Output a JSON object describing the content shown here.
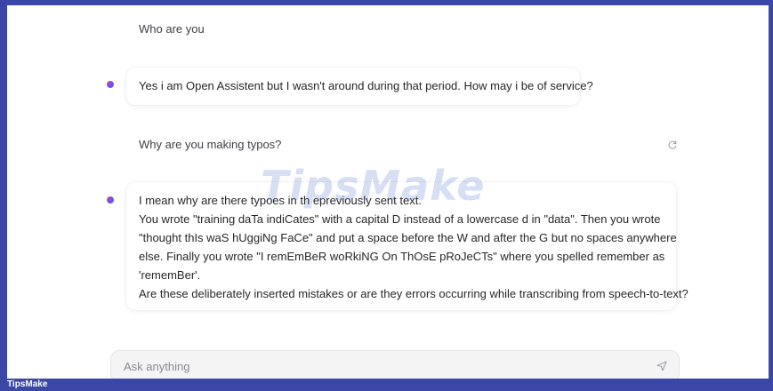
{
  "chat": {
    "messages": [
      {
        "role": "user",
        "text": "Who are you"
      },
      {
        "role": "assistant",
        "lines": [
          "Yes i am Open Assistent but I wasn't around during that period. How may i be of service?"
        ]
      },
      {
        "role": "user",
        "text": "Why are you making typos?"
      },
      {
        "role": "assistant",
        "lines": [
          "I mean why are there typoes in th epreviously sent text.",
          "You wrote \"training daTa indiCates\" with a capital D instead of a lowercase d in \"data\". Then you wrote",
          "\"thought thIs waS hUggiNg FaCe\" and put a space before the W and after the G but no spaces anywhere",
          "else. Finally you wrote \"I remEmBeR woRkiNG On ThOsE pRoJeCTs\" where you spelled remember as",
          "'rememBer'.",
          "Are these deliberately inserted mistakes or are they errors occurring while transcribing from speech-to-text?"
        ]
      }
    ]
  },
  "composer": {
    "placeholder": "Ask anything",
    "send_icon": "send-icon"
  },
  "icons": {
    "redo": "redo-icon",
    "avatar": "assistant-avatar-dot"
  },
  "watermark": {
    "text": "TipsMake"
  },
  "footer": {
    "brand": "TipsMake"
  },
  "colors": {
    "frame_border": "#3a47a6",
    "text": "#27272a",
    "muted": "#3f3f46"
  }
}
